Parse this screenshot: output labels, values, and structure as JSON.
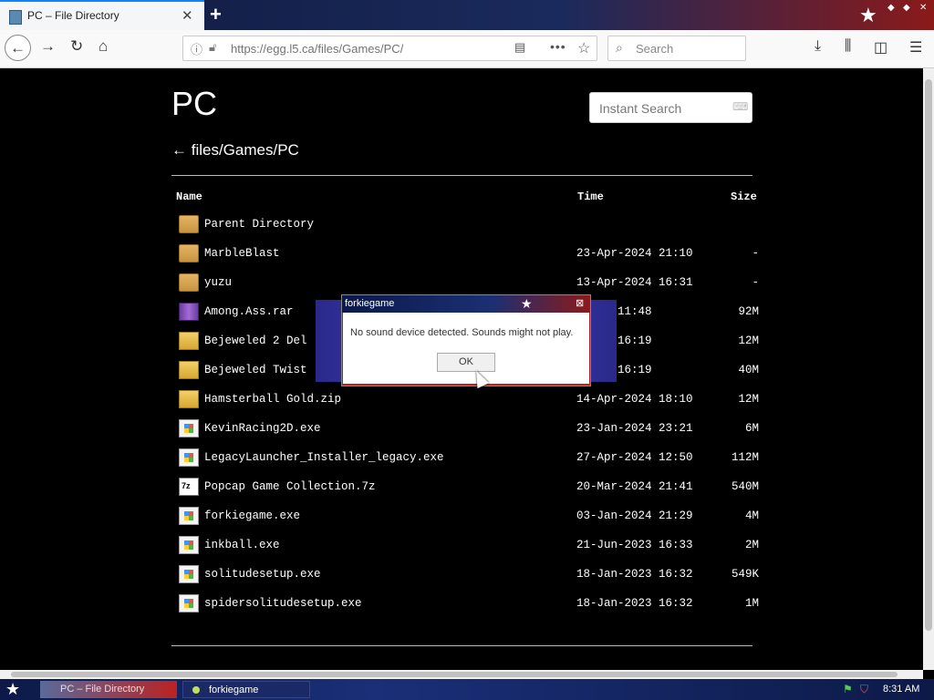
{
  "browser": {
    "tab_title": "PC – File Directory",
    "tab_close": "✕",
    "new_tab": "+",
    "url": "https://egg.l5.ca/files/Games/PC/",
    "search_placeholder": "Search"
  },
  "page": {
    "title": "PC",
    "instant_search_placeholder": "Instant Search",
    "breadcrumb": "← files/Games/PC",
    "columns": {
      "name": "Name",
      "time": "Time",
      "size": "Size"
    },
    "files": [
      {
        "type": "folder",
        "name": "Parent Directory",
        "time": "",
        "size": ""
      },
      {
        "type": "folder",
        "name": "MarbleBlast",
        "time": "23-Apr-2024 21:10",
        "size": "-"
      },
      {
        "type": "folder",
        "name": "yuzu",
        "time": "13-Apr-2024 16:31",
        "size": "-"
      },
      {
        "type": "rar",
        "name": "Among.Ass.rar",
        "time": "-2023 11:48",
        "size": "92M"
      },
      {
        "type": "zip",
        "name": "Bejeweled 2 Del",
        "time": "-2024 16:19",
        "size": "12M"
      },
      {
        "type": "zip",
        "name": "Bejeweled Twist",
        "time": "-2024 16:19",
        "size": "40M"
      },
      {
        "type": "zip",
        "name": "Hamsterball Gold.zip",
        "time": "14-Apr-2024 18:10",
        "size": "12M"
      },
      {
        "type": "exe",
        "name": "KevinRacing2D.exe",
        "time": "23-Jan-2024 23:21",
        "size": "6M"
      },
      {
        "type": "exe",
        "name": "LegacyLauncher_Installer_legacy.exe",
        "time": "27-Apr-2024 12:50",
        "size": "112M"
      },
      {
        "type": "sevenz",
        "name": "Popcap Game Collection.7z",
        "time": "20-Mar-2024 21:41",
        "size": "540M"
      },
      {
        "type": "exe",
        "name": "forkiegame.exe",
        "time": "03-Jan-2024 21:29",
        "size": "4M"
      },
      {
        "type": "exe",
        "name": "inkball.exe",
        "time": "21-Jun-2023 16:33",
        "size": "2M"
      },
      {
        "type": "exe",
        "name": "solitudesetup.exe",
        "time": "18-Jan-2023 16:32",
        "size": "549K"
      },
      {
        "type": "exe",
        "name": "spidersolitudesetup.exe",
        "time": "18-Jan-2023 16:32",
        "size": "1M"
      }
    ]
  },
  "dialog": {
    "title": "forkiegame",
    "message": "No sound device detected. Sounds might not play.",
    "ok_label": "OK"
  },
  "taskbar": {
    "browser_task": "PC – File Directory",
    "game_task": "forkiegame",
    "clock": "8:31 AM"
  }
}
